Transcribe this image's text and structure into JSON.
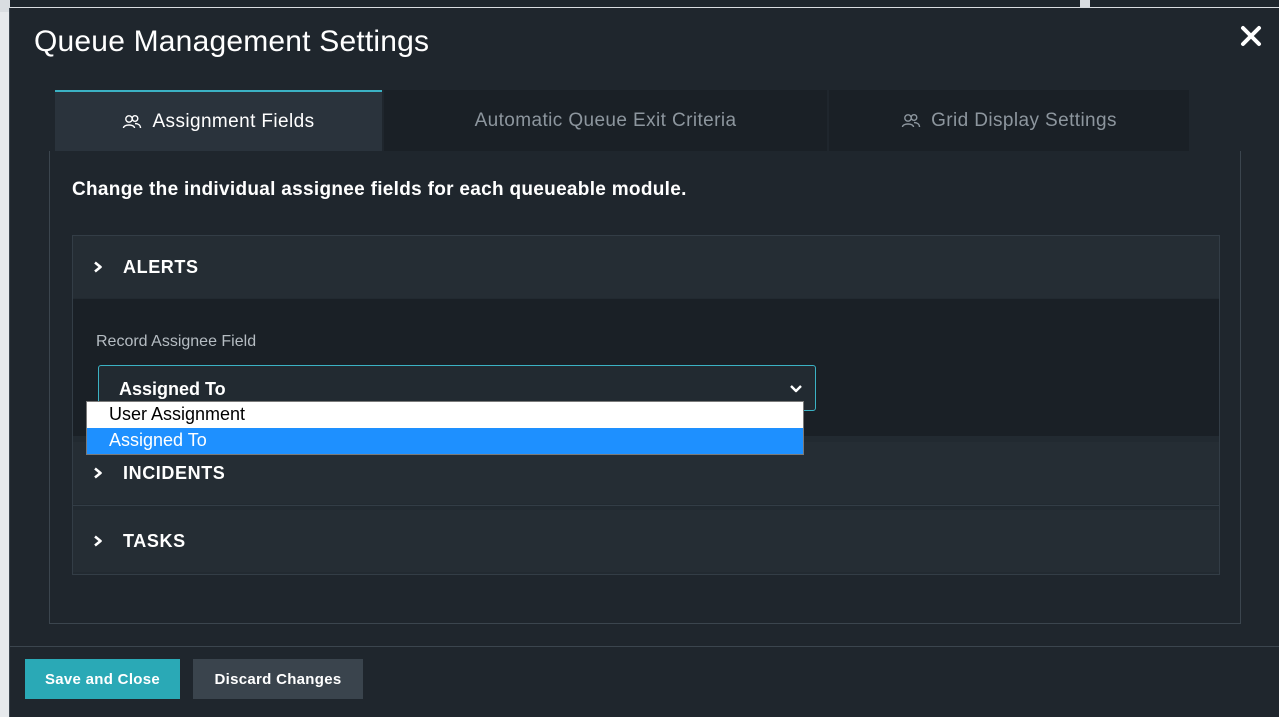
{
  "modal": {
    "title": "Queue Management Settings"
  },
  "tabs": [
    {
      "label": "Assignment Fields",
      "active": true,
      "icon": "users-icon"
    },
    {
      "label": "Automatic Queue Exit Criteria",
      "active": false,
      "icon": ""
    },
    {
      "label": "Grid Display Settings",
      "active": false,
      "icon": "users-icon"
    }
  ],
  "content": {
    "intro": "Change the individual assignee fields for each queueable module."
  },
  "modules": [
    {
      "label": "ALERTS",
      "expanded": true,
      "field_label": "Record Assignee Field",
      "selected_value": "Assigned To",
      "options": [
        "User Assignment",
        "Assigned To"
      ]
    },
    {
      "label": "INCIDENTS",
      "expanded": false
    },
    {
      "label": "TASKS",
      "expanded": false
    }
  ],
  "footer": {
    "save_label": "Save and Close",
    "discard_label": "Discard Changes"
  },
  "colors": {
    "accent": "#2aa9b6",
    "highlight": "#1e90ff",
    "background": "#1f262d"
  }
}
